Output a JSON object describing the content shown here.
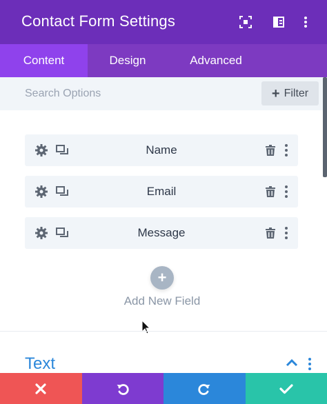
{
  "header": {
    "title": "Contact Form Settings",
    "icons": [
      "expand-icon",
      "sidebar-layout-icon",
      "more-vertical-icon"
    ]
  },
  "tabs": [
    {
      "label": "Content",
      "active": true
    },
    {
      "label": "Design",
      "active": false
    },
    {
      "label": "Advanced",
      "active": false
    }
  ],
  "search": {
    "placeholder": "Search Options",
    "value": ""
  },
  "filter": {
    "label": "Filter",
    "icon": "plus-icon"
  },
  "fields": [
    {
      "label": "Name"
    },
    {
      "label": "Email"
    },
    {
      "label": "Message"
    }
  ],
  "add_field": {
    "label": "Add New Field",
    "icon": "plus-icon"
  },
  "section": {
    "title": "Text",
    "icons": [
      "chevron-up-icon",
      "more-vertical-icon"
    ]
  },
  "footer": [
    {
      "icon": "close-icon",
      "color": "#ef5555"
    },
    {
      "icon": "undo-icon",
      "color": "#7e3bd0"
    },
    {
      "icon": "redo-icon",
      "color": "#2b87da"
    },
    {
      "icon": "check-icon",
      "color": "#29c4a9"
    }
  ],
  "colors": {
    "header": "#6c2eb9",
    "tabs": "#7d3ac1",
    "active_tab": "#8f42ec",
    "accent_blue": "#2b87da"
  }
}
